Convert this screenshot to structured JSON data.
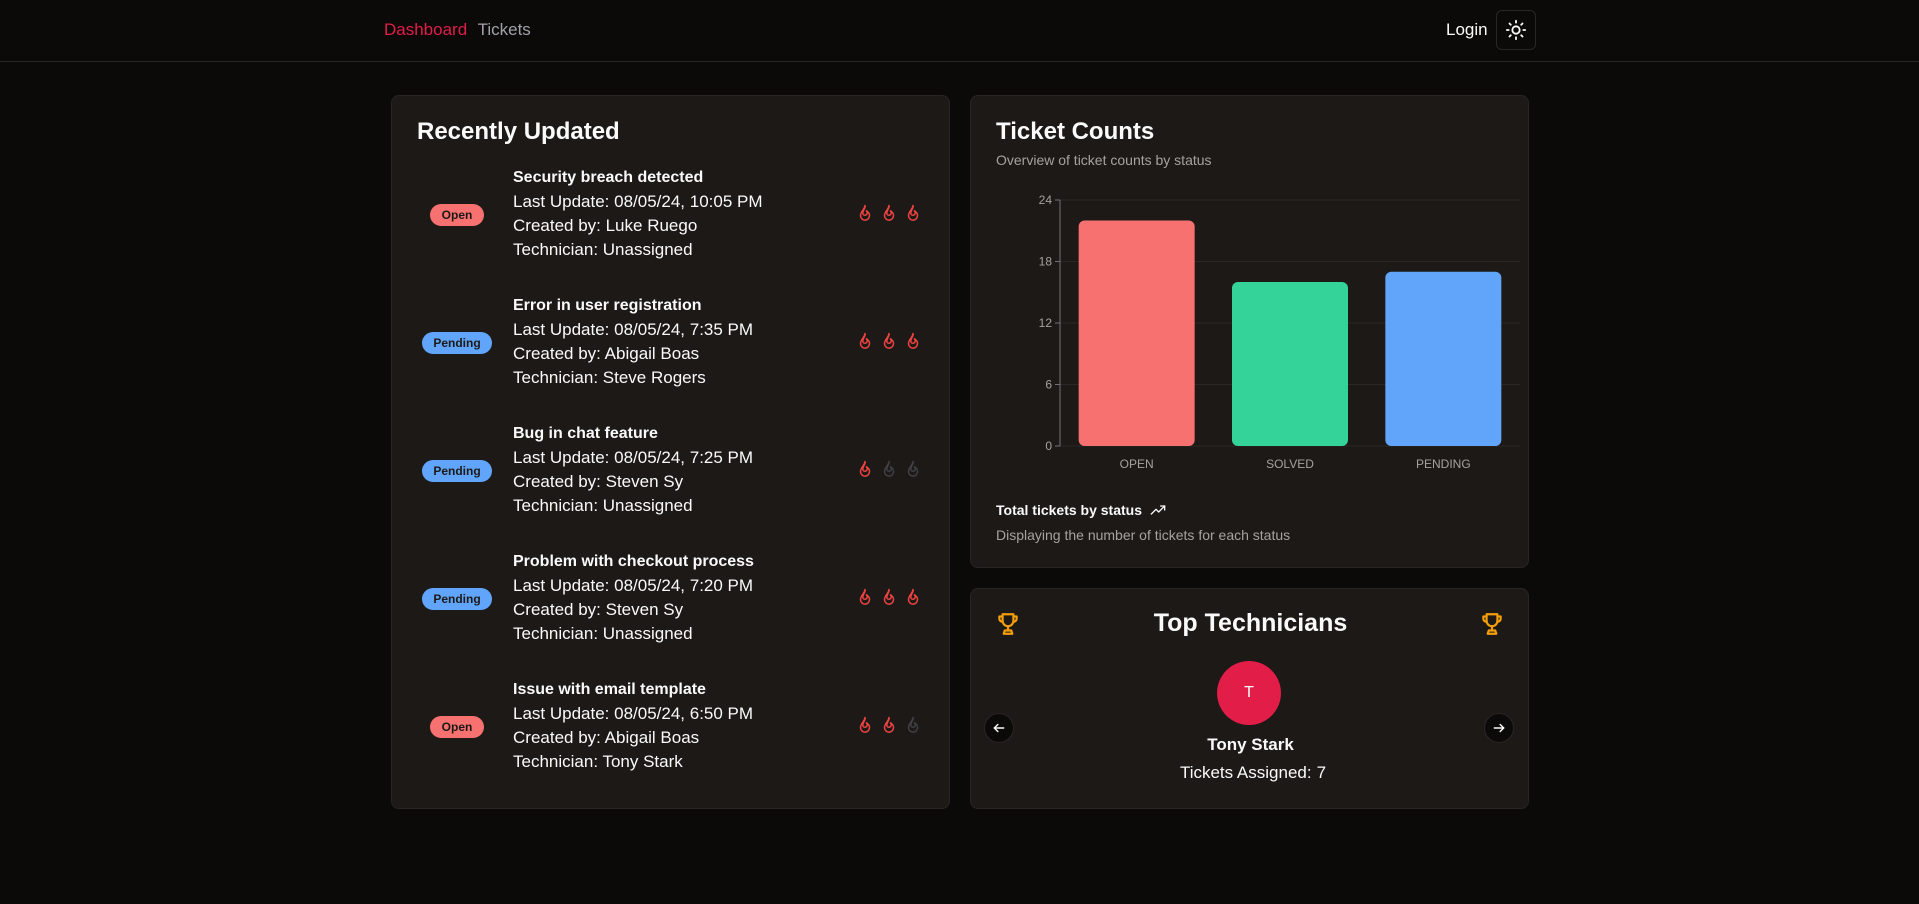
{
  "nav": {
    "dashboard": "Dashboard",
    "tickets": "Tickets",
    "login": "Login",
    "theme_icon": "sun-icon"
  },
  "recent": {
    "title": "Recently Updated",
    "tickets": [
      {
        "status": "Open",
        "title": "Security breach detected",
        "last_update": "Last Update: 08/05/24, 10:05 PM",
        "created_by": "Created by: Luke Ruego",
        "technician": "Technician: Unassigned",
        "priority": 3
      },
      {
        "status": "Pending",
        "title": "Error in user registration",
        "last_update": "Last Update: 08/05/24, 7:35 PM",
        "created_by": "Created by: Abigail Boas",
        "technician": "Technician: Steve Rogers",
        "priority": 3
      },
      {
        "status": "Pending",
        "title": "Bug in chat feature",
        "last_update": "Last Update: 08/05/24, 7:25 PM",
        "created_by": "Created by: Steven Sy",
        "technician": "Technician: Unassigned",
        "priority": 1
      },
      {
        "status": "Pending",
        "title": "Problem with checkout process",
        "last_update": "Last Update: 08/05/24, 7:20 PM",
        "created_by": "Created by: Steven Sy",
        "technician": "Technician: Unassigned",
        "priority": 3
      },
      {
        "status": "Open",
        "title": "Issue with email template",
        "last_update": "Last Update: 08/05/24, 6:50 PM",
        "created_by": "Created by: Abigail Boas",
        "technician": "Technician: Tony Stark",
        "priority": 2
      }
    ]
  },
  "counts": {
    "title": "Ticket Counts",
    "subtitle": "Overview of ticket counts by status",
    "footer_title": "Total tickets by status",
    "footer_sub": "Displaying the number of tickets for each status"
  },
  "chart_data": {
    "type": "bar",
    "categories": [
      "OPEN",
      "SOLVED",
      "PENDING"
    ],
    "values": [
      22,
      16,
      17
    ],
    "colors": [
      "#f87171",
      "#34d399",
      "#60a5fa"
    ],
    "ylim": [
      0,
      24
    ],
    "yticks": [
      0,
      6,
      12,
      18,
      24
    ],
    "grid": true
  },
  "tech": {
    "title": "Top Technicians",
    "avatar_letter": "T",
    "name": "Tony Stark",
    "assigned_label": "Tickets Assigned:",
    "assigned_count": "7"
  },
  "colors": {
    "brand": "#e11d48",
    "open": "#f87171",
    "pending": "#60a5fa",
    "solved": "#34d399",
    "flame_active": "#ef4444",
    "flame_inactive": "#3f3f46",
    "trophy": "#f59e0b"
  }
}
